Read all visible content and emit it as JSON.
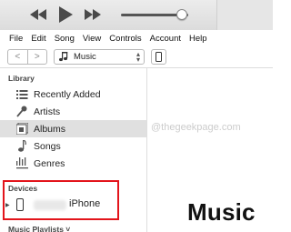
{
  "player": {
    "rewind_icon": "rewind-icon",
    "play_icon": "play-icon",
    "forward_icon": "fast-forward-icon",
    "volume_level": 0.9
  },
  "menu": [
    "File",
    "Edit",
    "Song",
    "View",
    "Controls",
    "Account",
    "Help"
  ],
  "toolbar": {
    "back_glyph": "<",
    "forward_glyph": ">",
    "media_label": "Music",
    "media_icon": "music-note-icon",
    "device_icon": "phone-icon"
  },
  "sidebar": {
    "library_title": "Library",
    "items": [
      {
        "label": "Recently Added",
        "icon": "recently-added-icon"
      },
      {
        "label": "Artists",
        "icon": "microphone-icon"
      },
      {
        "label": "Albums",
        "icon": "album-icon"
      },
      {
        "label": "Songs",
        "icon": "music-note-icon"
      },
      {
        "label": "Genres",
        "icon": "genres-icon"
      }
    ],
    "devices_title": "Devices",
    "device_name": "iPhone",
    "playlists_title": "Music Playlists ˅"
  },
  "main": {
    "watermark": "@thegeekpage.com",
    "title": "Music"
  },
  "colors": {
    "highlight_box": "#e3141b",
    "selected_row": "#e0e0e0"
  }
}
